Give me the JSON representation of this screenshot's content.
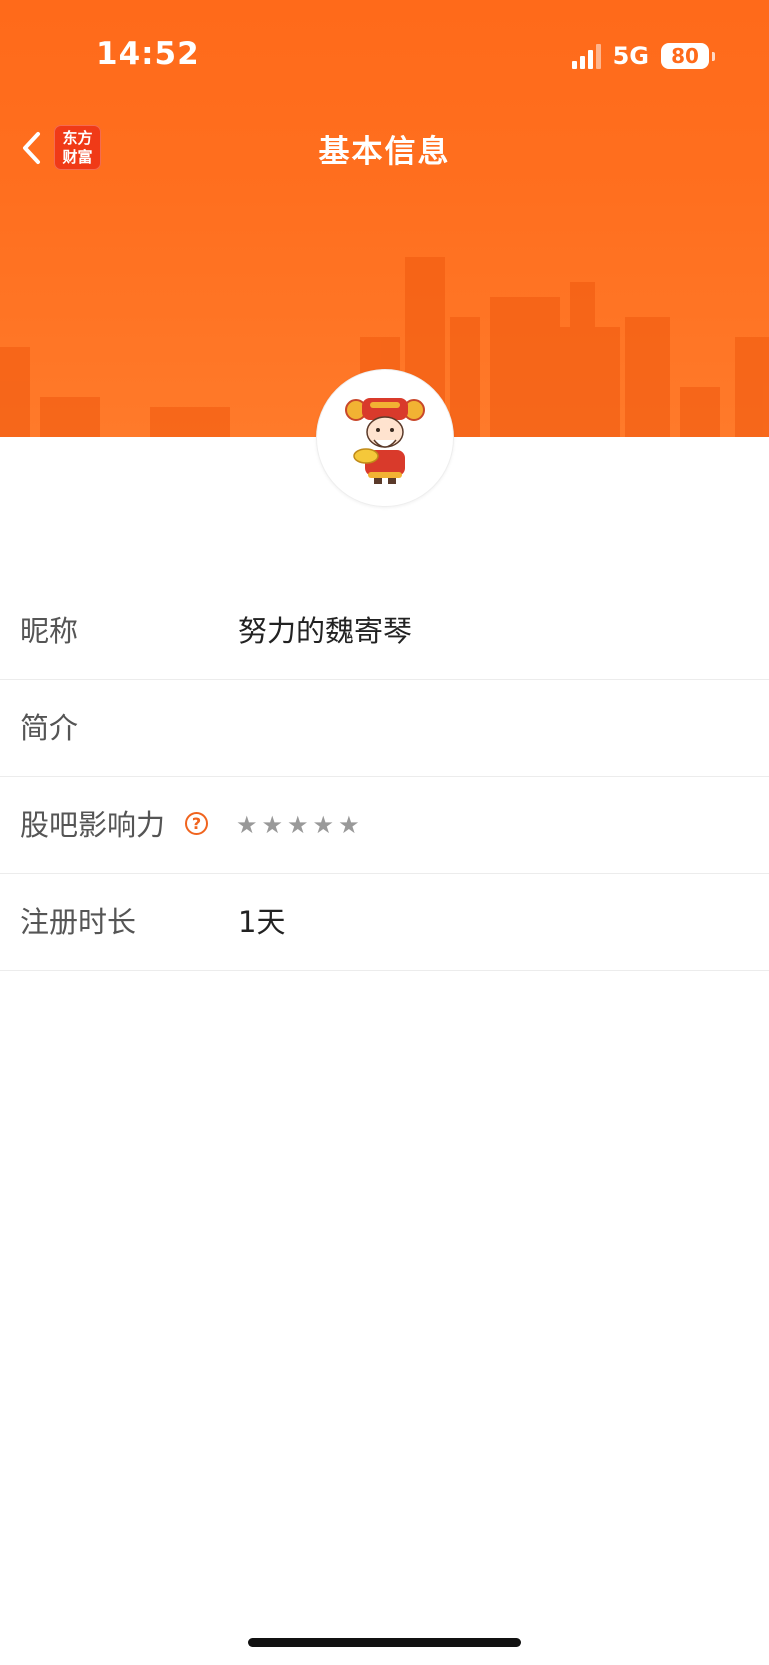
{
  "status_bar": {
    "time": "14:52",
    "network": "5G",
    "battery": "80"
  },
  "nav": {
    "logo_line1": "东方",
    "logo_line2": "财富",
    "title": "基本信息"
  },
  "profile": {
    "rows": [
      {
        "label": "昵称",
        "value": "努力的魏寄琴"
      },
      {
        "label": "简介",
        "value": ""
      },
      {
        "label": "股吧影响力",
        "help": "?",
        "rating": 0,
        "max_rating": 5
      },
      {
        "label": "注册时长",
        "value": "1天"
      }
    ]
  },
  "colors": {
    "brand_orange": "#ff6a1a",
    "help_orange": "#f0641e",
    "star_gray": "#999999"
  }
}
